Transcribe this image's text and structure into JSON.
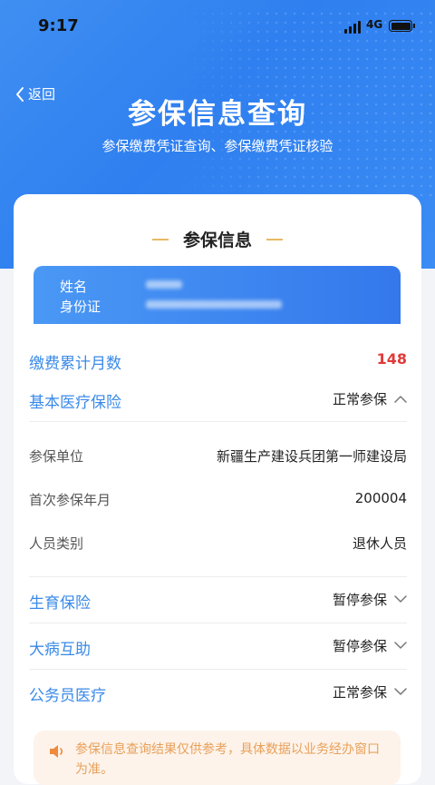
{
  "status_bar": {
    "time": "9:17",
    "network": "4G"
  },
  "header": {
    "back_label": "返回",
    "title": "参保信息查询",
    "subtitle": "参保缴费凭证查询、参保缴费凭证核验"
  },
  "card": {
    "title": "参保信息",
    "identity": {
      "name_label": "姓名",
      "id_label": "身份证"
    },
    "summary": {
      "label": "缴费累计月数",
      "value": "148"
    },
    "medical": {
      "label": "基本医疗保险",
      "status": "正常参保",
      "details": [
        {
          "label": "参保单位",
          "value": "新疆生产建设兵团第一师建设局"
        },
        {
          "label": "首次参保年月",
          "value": "200004"
        },
        {
          "label": "人员类别",
          "value": "退休人员"
        }
      ]
    },
    "insurances": [
      {
        "label": "生育保险",
        "status": "暂停参保"
      },
      {
        "label": "大病互助",
        "status": "暂停参保"
      },
      {
        "label": "公务员医疗",
        "status": "正常参保"
      }
    ],
    "notice": "参保信息查询结果仅供参考，具体数据以业务经办窗口为准。"
  },
  "colors": {
    "primary": "#3a8ae8",
    "accent_red": "#e03a3a",
    "notice_bg": "#fdf3ea",
    "notice_text": "#e8a05a",
    "title_line": "#e8b964"
  },
  "icons": {
    "back": "chevron-left-icon",
    "expanded": "chevron-up-icon",
    "collapsed": "chevron-down-icon",
    "notice": "speaker-icon"
  }
}
